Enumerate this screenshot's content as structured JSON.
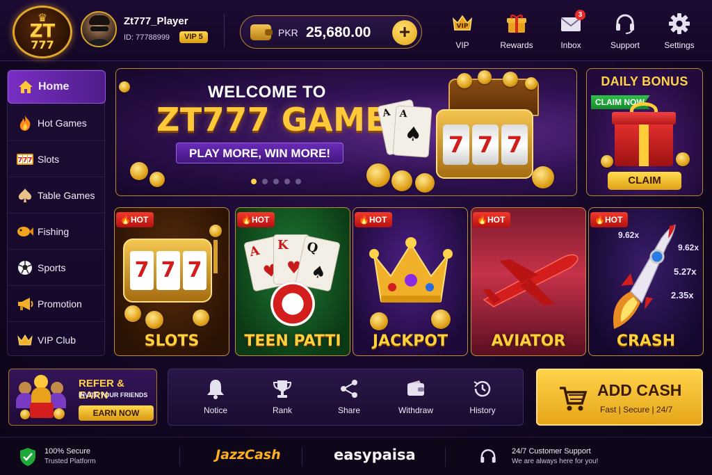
{
  "brand": {
    "logo_line1": "ZT",
    "logo_line2": "777"
  },
  "player": {
    "name": "Zt777_Player",
    "id_text": "ID: 77788999",
    "vip_badge": "VIP 5"
  },
  "balance": {
    "currency": "PKR",
    "amount": "25,680.00"
  },
  "top_nav": [
    {
      "label": "VIP",
      "icon": "vip-crown-icon"
    },
    {
      "label": "Rewards",
      "icon": "gift-icon"
    },
    {
      "label": "Inbox",
      "icon": "mail-icon",
      "badge": "3"
    },
    {
      "label": "Support",
      "icon": "headset-icon"
    },
    {
      "label": "Settings",
      "icon": "gear-icon"
    }
  ],
  "sidebar": {
    "items": [
      {
        "label": "Home",
        "icon": "home-icon",
        "active": true
      },
      {
        "label": "Hot Games",
        "icon": "flame-icon"
      },
      {
        "label": "Slots",
        "icon": "slots-777-icon"
      },
      {
        "label": "Table Games",
        "icon": "spade-icon"
      },
      {
        "label": "Fishing",
        "icon": "fish-icon"
      },
      {
        "label": "Sports",
        "icon": "soccer-ball-icon"
      },
      {
        "label": "Promotion",
        "icon": "megaphone-icon"
      },
      {
        "label": "VIP Club",
        "icon": "crown-icon"
      }
    ]
  },
  "banner": {
    "welcome": "WELCOME TO",
    "title": "ZT777 GAME",
    "tagline": "PLAY MORE, WIN MORE!",
    "slot_digits": [
      "7",
      "7",
      "7"
    ],
    "card1": "A",
    "card2": "A",
    "slides": 5,
    "active_slide": 1
  },
  "daily_bonus": {
    "title": "DAILY BONUS",
    "ribbon": "CLAIM NOW",
    "button": "CLAIM"
  },
  "games": [
    {
      "name": "SLOTS",
      "tag": "HOT",
      "theme": "slots"
    },
    {
      "name": "TEEN PATTI",
      "tag": "HOT",
      "theme": "teenpatti",
      "cards": [
        "A",
        "K",
        "Q"
      ]
    },
    {
      "name": "JACKPOT",
      "tag": "HOT",
      "theme": "jackpot"
    },
    {
      "name": "AVIATOR",
      "tag": "HOT",
      "theme": "aviator"
    },
    {
      "name": "CRASH",
      "tag": "HOT",
      "theme": "crash",
      "multipliers": [
        "9.62x",
        "9.62x",
        "5.27x",
        "2.35x"
      ]
    }
  ],
  "refer": {
    "title": "REFER & EARN",
    "subtitle": "INVITE YOUR FRIENDS",
    "button": "EARN NOW"
  },
  "quick_actions": [
    {
      "label": "Notice",
      "icon": "bell-icon"
    },
    {
      "label": "Rank",
      "icon": "trophy-icon"
    },
    {
      "label": "Share",
      "icon": "share-icon"
    },
    {
      "label": "Withdraw",
      "icon": "wallet-icon"
    },
    {
      "label": "History",
      "icon": "history-clock-icon"
    }
  ],
  "add_cash": {
    "title": "ADD CASH",
    "subtitle": "Fast | Secure | 24/7"
  },
  "footer": {
    "secure_title": "100% Secure",
    "secure_sub": "Trusted Platform",
    "jazzcash": "JazzCash",
    "easypaisa": "easypaisa",
    "support_title": "24/7 Customer Support",
    "support_sub": "We are always here for you!"
  },
  "colors": {
    "accent_gold": "#ffc83a",
    "brand_purple": "#7a2fc4",
    "hot_red": "#d8201a",
    "claim_green": "#1fa83a"
  }
}
